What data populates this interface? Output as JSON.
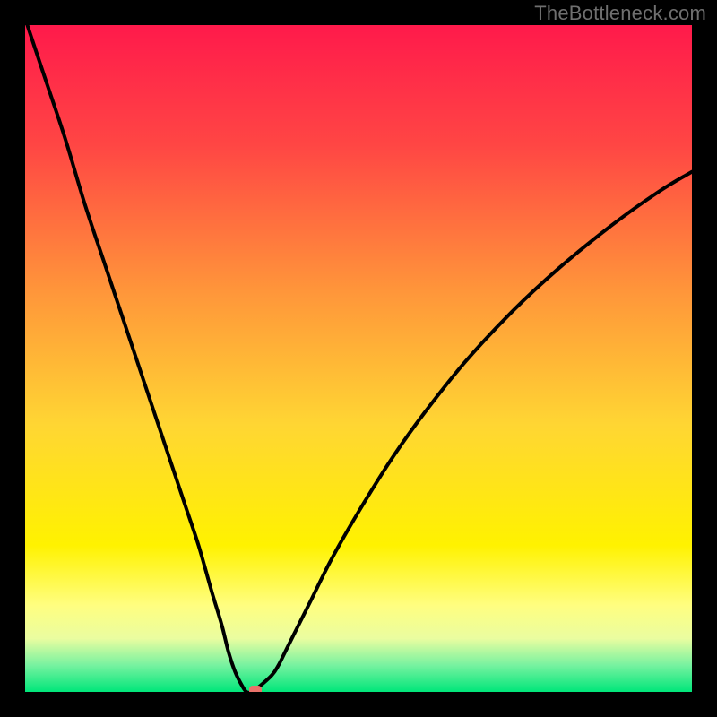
{
  "watermark": "TheBottleneck.com",
  "chart_data": {
    "type": "line",
    "title": "",
    "xlabel": "",
    "ylabel": "",
    "xlim": [
      0,
      100
    ],
    "ylim": [
      0,
      100
    ],
    "grid": false,
    "legend": false,
    "background_gradient": {
      "stops": [
        {
          "pct": 0,
          "color": "#ff1a4b"
        },
        {
          "pct": 18,
          "color": "#ff4644"
        },
        {
          "pct": 40,
          "color": "#ff963a"
        },
        {
          "pct": 60,
          "color": "#ffd633"
        },
        {
          "pct": 78,
          "color": "#fff200"
        },
        {
          "pct": 87,
          "color": "#fffe80"
        },
        {
          "pct": 92,
          "color": "#eafda0"
        },
        {
          "pct": 96,
          "color": "#77f2a0"
        },
        {
          "pct": 100,
          "color": "#00e67a"
        }
      ]
    },
    "series": [
      {
        "name": "bottleneck-curve",
        "color": "#000000",
        "x": [
          0,
          3,
          6,
          9,
          12,
          15,
          18,
          21,
          24,
          26,
          28,
          29.5,
          30.5,
          31.5,
          32.5,
          33.2,
          34.0,
          35.0,
          37.0,
          38.0,
          39.0,
          40.5,
          43.0,
          46.0,
          50.0,
          55.0,
          60.0,
          66.0,
          73.0,
          80.0,
          88.0,
          95.0,
          100.0
        ],
        "y": [
          101,
          92,
          83,
          73,
          64,
          55,
          46,
          37,
          28,
          22,
          15,
          10,
          6,
          3,
          1,
          0,
          0,
          0.7,
          2.5,
          4.0,
          6.0,
          9.0,
          14.0,
          20.0,
          27.0,
          35.0,
          42.0,
          49.5,
          57.0,
          63.5,
          70.0,
          75.0,
          78.0
        ]
      }
    ],
    "markers": [
      {
        "name": "highlight-dot",
        "x": 34.5,
        "y": 0.3,
        "color": "#e9726a"
      }
    ]
  }
}
